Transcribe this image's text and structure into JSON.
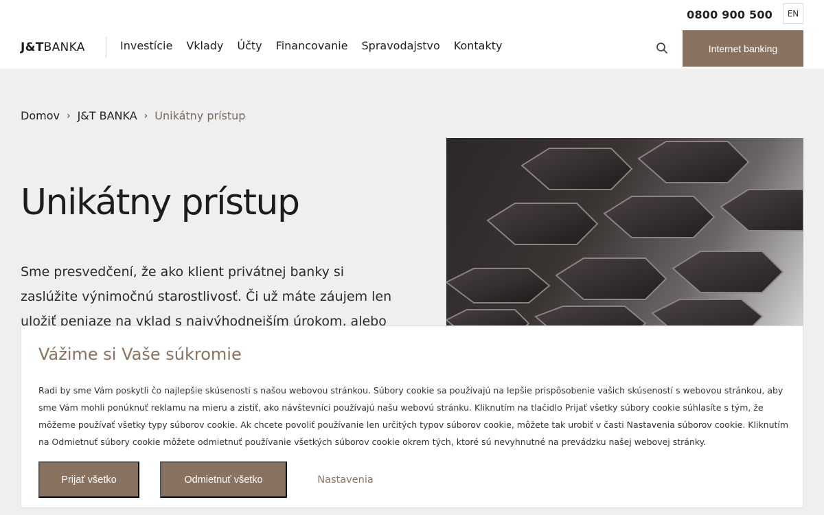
{
  "header": {
    "phone": "0800 900 500",
    "lang": "EN",
    "logo_jt": "J&T",
    "logo_banka": "BANKA",
    "nav": [
      "Investície",
      "Vklady",
      "Účty",
      "Financovanie",
      "Spravodajstvo",
      "Kontakty"
    ],
    "internet_banking": "Internet banking"
  },
  "breadcrumb": {
    "items": [
      "Domov",
      "J&T BANKA"
    ],
    "current": "Unikátny prístup"
  },
  "hero": {
    "title": "Unikátny prístup",
    "text": "Sme presvedčení, že ako klient privátnej banky si zaslúžite výnimočnú starostlivosť. Či už máte záujem len uložiť peniaze na vklad s najvýhodnejším úrokom, alebo patríte"
  },
  "cookie": {
    "title": "Vážime si Vaše súkromie",
    "text": "Radi by sme Vám poskytli čo najlepšie skúsenosti s našou webovou stránkou. Súbory cookie sa používajú na lepšie prispôsobenie vašich skúseností s webovou stránkou, aby sme Vám mohli ponúknuť reklamu na mieru a zistiť, ako návštevníci používajú našu webovú stránku. Kliknutím na tlačidlo Prijať všetky súbory cookie súhlasíte s tým, že môžeme používať všetky typy súborov cookie. Ak chcete povoliť používanie len určitých typov súborov cookie, môžete tak urobiť v časti Nastavenia súborov cookie. Kliknutím na Odmietnuť súbory cookie môžete odmietnuť používanie všetkých súborov cookie okrem tých, ktoré sú nevyhnutné na prevádzku našej webovej stránky.",
    "accept": "Prijať všetko",
    "reject": "Odmietnuť všetko",
    "settings": "Nastavenia"
  },
  "colors": {
    "accent": "#8a7261",
    "header_bg": "#ffffff",
    "page_bg": "#efefef"
  }
}
